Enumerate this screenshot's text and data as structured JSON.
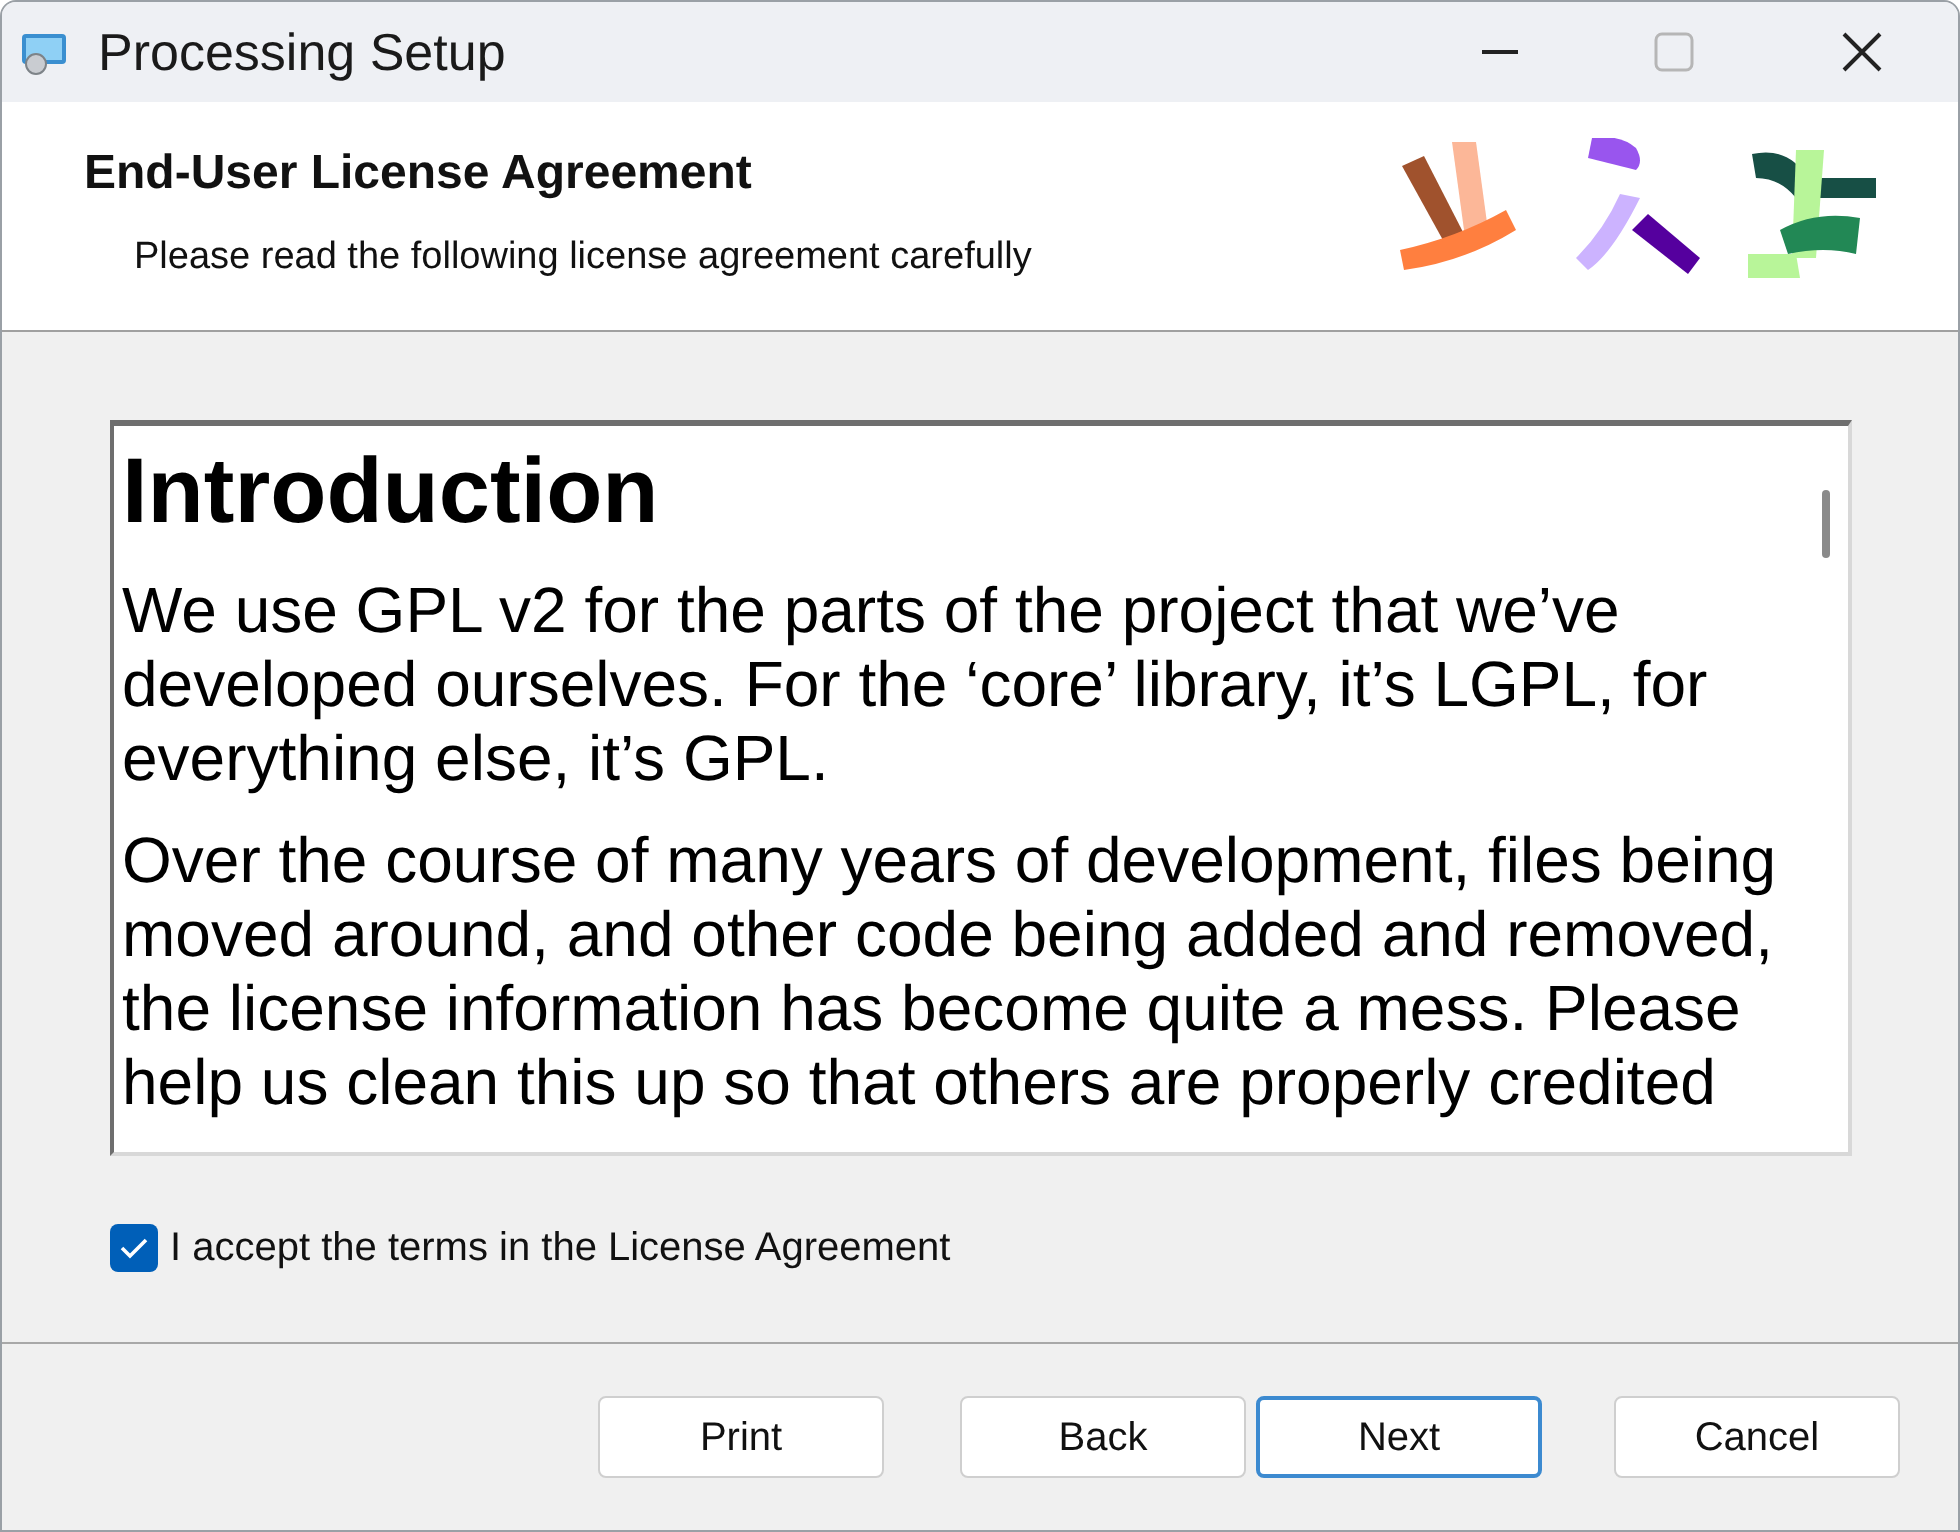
{
  "window": {
    "title": "Processing Setup"
  },
  "header": {
    "title": "End-User License Agreement",
    "subtitle": "Please read the following license agreement carefully"
  },
  "license": {
    "heading": "Introduction",
    "paragraphs": [
      "We use GPL v2 for the parts of the project that we’ve developed ourselves. For the ‘core’ library, it’s LGPL, for everything else, it’s GPL.",
      "Over the course of many years of development, files being moved around, and other code being added and removed, the license information has become quite a mess. Please help us clean this up so that others are properly credited"
    ]
  },
  "accept": {
    "label": "I accept the terms in the License Agreement",
    "checked": true
  },
  "buttons": [
    {
      "label": "Print",
      "default": false
    },
    {
      "label": "Back",
      "default": false
    },
    {
      "label": "Next",
      "default": true
    },
    {
      "label": "Cancel",
      "default": false
    }
  ]
}
